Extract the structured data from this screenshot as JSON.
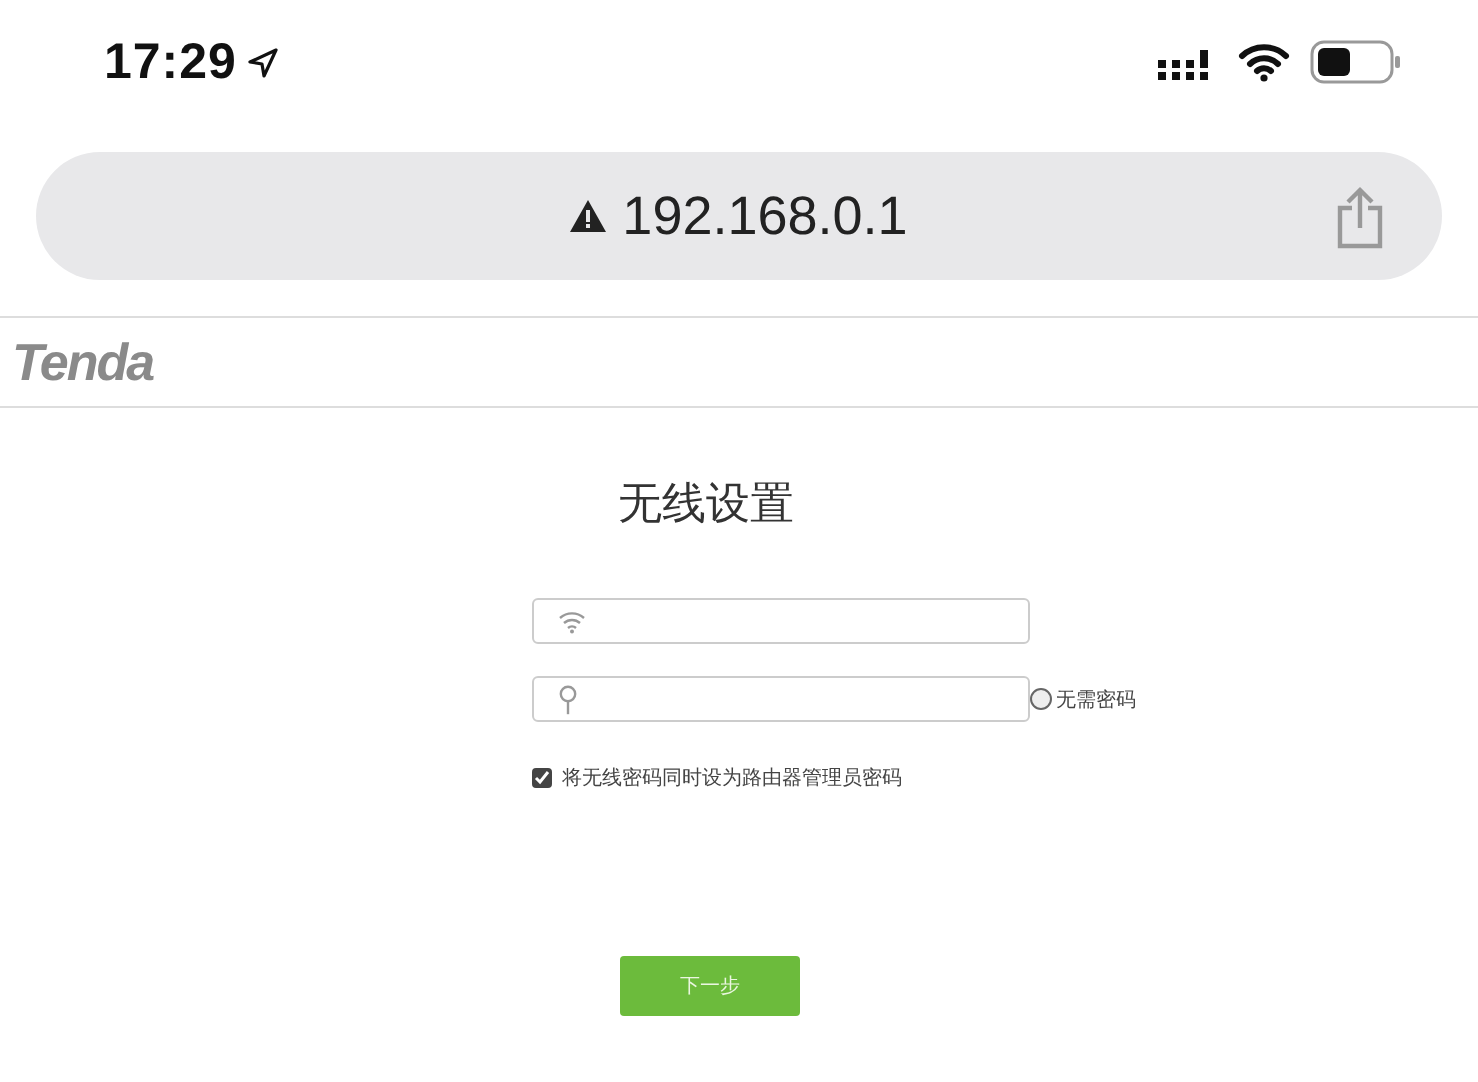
{
  "status_bar": {
    "time": "17:29"
  },
  "address_bar": {
    "url": "192.168.0.1",
    "insecure": true
  },
  "header": {
    "logo": "Tenda"
  },
  "form": {
    "title": "无线设置",
    "ssid_field": {
      "kind": "wifi"
    },
    "password_field": {
      "kind": "key"
    },
    "no_password": {
      "label": "无需密码",
      "checked": false
    },
    "same_as_admin": {
      "label": "将无线密码同时设为路由器管理员密码",
      "checked": true
    },
    "next_button": "下一步"
  }
}
